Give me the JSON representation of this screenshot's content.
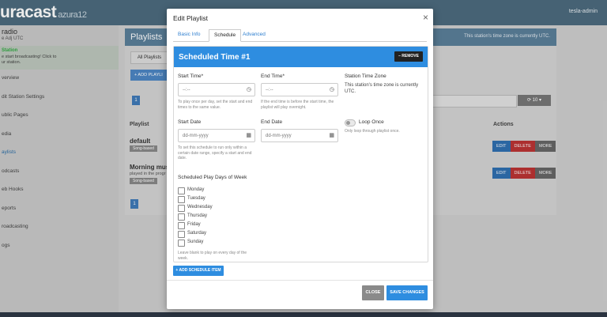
{
  "app": {
    "brand": "uracast",
    "brand_suffix": "azura12",
    "user": "tesla-admin"
  },
  "sidebar": {
    "station": "radio",
    "timezone": "e Adj UTC",
    "notice_title": "Station",
    "notice_text": "e start broadcasting! Click to ur station.",
    "items": [
      {
        "label": "verview"
      },
      {
        "label": "dit Station Settings"
      },
      {
        "label": "ublic Pages"
      },
      {
        "label": "edia"
      },
      {
        "label": "aylists"
      },
      {
        "label": "odcasts"
      },
      {
        "label": "eb Hooks"
      },
      {
        "label": "eports"
      },
      {
        "label": "roadcasting"
      },
      {
        "label": "ogs"
      }
    ]
  },
  "background": {
    "panel_title": "Playlists",
    "panel_note": "This station's time zone is currently UTC.",
    "tab_all": "All Playlists",
    "add_button": "+ ADD PLAYLI",
    "page_number": "1",
    "col_playlist": "Playlist",
    "col_actions": "Actions",
    "rows": [
      {
        "name": "default",
        "badge": "Song-based",
        "sub": ""
      },
      {
        "name": "Morning music",
        "badge": "Song-based",
        "sub": "played in the progr"
      }
    ],
    "actions": {
      "edit": "EDIT",
      "delete": "DELETE",
      "more": "MORE"
    },
    "per_page": "10"
  },
  "modal": {
    "title": "Edit Playlist",
    "close_glyph": "×",
    "tabs": [
      {
        "label": "Basic Info"
      },
      {
        "label": "Schedule"
      },
      {
        "label": "Advanced"
      }
    ],
    "schedule": {
      "card_title": "Scheduled Time #1",
      "remove_label": "– REMOVE",
      "start_time_label": "Start Time*",
      "start_time_value": "--:--",
      "start_time_help": "To play once per day, set the start and end times to the same value.",
      "end_time_label": "End Time*",
      "end_time_value": "--:--",
      "end_time_help": "If the end time is before the start time, the playlist will play overnight.",
      "tz_label": "Station Time Zone",
      "tz_text": "This station's time zone is currently UTC.",
      "start_date_label": "Start Date",
      "start_date_value": "dd-mm-yyyy",
      "start_date_help": "To set this schedule to run only within a certain date range, specify a start and end date.",
      "end_date_label": "End Date",
      "end_date_value": "dd-mm-yyyy",
      "loop_label": "Loop Once",
      "loop_help": "Only loop through playlist once.",
      "days_label": "Scheduled Play Days of Week",
      "days": [
        "Monday",
        "Tuesday",
        "Wednesday",
        "Thursday",
        "Friday",
        "Saturday",
        "Sunday"
      ],
      "days_help": "Leave blank to play on every day of the week."
    },
    "add_schedule_label": "+ ADD SCHEDULE ITEM",
    "close_label": "CLOSE",
    "save_label": "SAVE CHANGES"
  },
  "colors": {
    "accent": "#2e8de0",
    "topbar": "#4d6b7e",
    "danger": "#bb3333"
  }
}
